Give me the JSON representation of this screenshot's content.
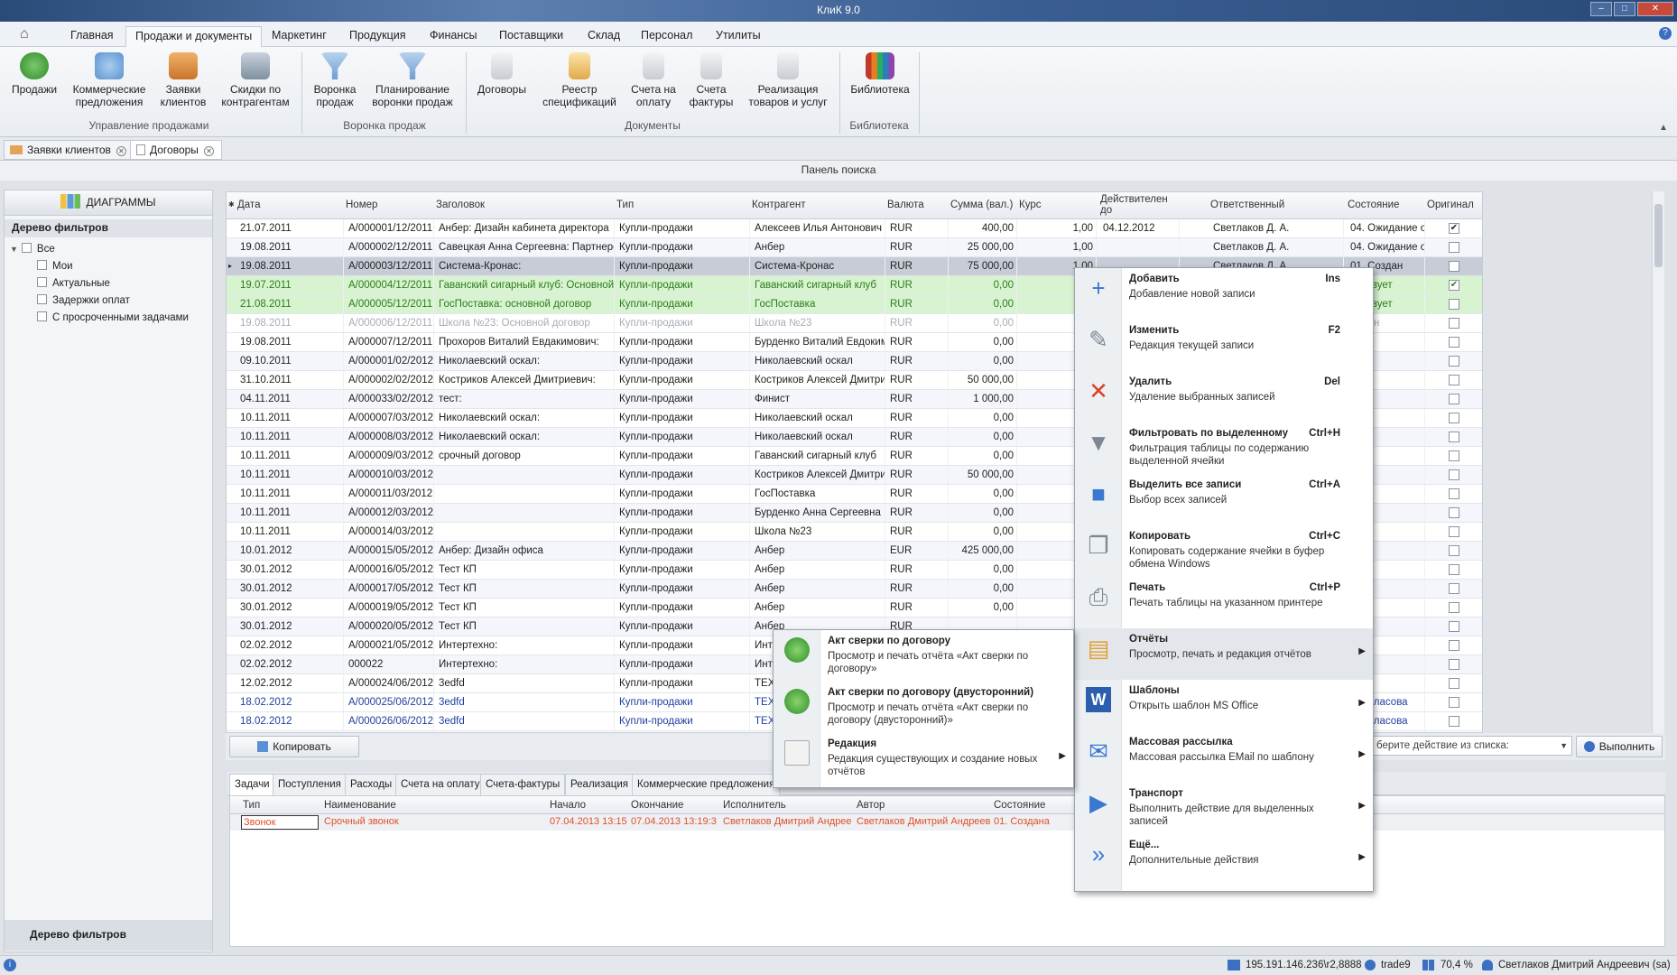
{
  "app": {
    "title": "КлиК 9.0"
  },
  "menu_tabs": [
    "Главная",
    "Продажи и документы",
    "Маркетинг",
    "Продукция",
    "Финансы",
    "Поставщики",
    "Склад",
    "Персонал",
    "Утилиты"
  ],
  "ribbon": {
    "buttons": [
      "Продажи",
      "Коммерческие предложения",
      "Заявки клиентов",
      "Скидки по контрагентам",
      "Воронка продаж",
      "Планирование воронки продаж",
      "Договоры",
      "Реестр спецификаций",
      "Счета на оплату",
      "Счета фактуры",
      "Реализация товаров и услуг",
      "Библиотека"
    ],
    "groups": [
      "Управление продажами",
      "Воронка продаж",
      "Документы",
      "Библиотека"
    ]
  },
  "doc_tabs": [
    "Заявки клиентов",
    "Договоры"
  ],
  "search_panel": "Панель поиска",
  "left": {
    "diagrams": "ДИАГРАММЫ",
    "tree_header": "Дерево фильтров",
    "tree_root": "Все",
    "tree_items": [
      "Мои",
      "Актуальные",
      "Задержки оплат",
      "С просроченными задачами"
    ],
    "tree_footer": "Дерево фильтров"
  },
  "grid": {
    "columns": [
      "Дата",
      "Номер",
      "Заголовок",
      "Тип",
      "Контрагент",
      "Валюта",
      "Сумма (вал.)",
      "Курс",
      "Действителен до",
      "Ответственный",
      "Состояние",
      "Оригинал"
    ],
    "rows": [
      [
        "21.07.2011",
        "A/000001/12/2011",
        "Анбер: Дизайн кабинета директора",
        "Купли-продажи",
        "Алексеев Илья Антонович",
        "RUR",
        "400,00",
        "1,00",
        "04.12.2012",
        "Светлаков Д. А.",
        "04. Ожидание ор"
      ],
      [
        "19.08.2011",
        "A/000002/12/2011",
        "Савецкая Анна Сергеевна: Партнерст",
        "Купли-продажи",
        "Анбер",
        "RUR",
        "25 000,00",
        "1,00",
        "",
        "Светлаков Д. А.",
        "04. Ожидание ор"
      ],
      [
        "19.08.2011",
        "A/000003/12/2011",
        "Система-Кронас:",
        "Купли-продажи",
        "Система-Кронас",
        "RUR",
        "75 000,00",
        "1,00",
        "",
        "Светлаков Д. А.",
        "01. Создан"
      ],
      [
        "19.07.2011",
        "A/000004/12/2011",
        "Гаванский сигарный клуб: Основной д",
        "Купли-продажи",
        "Гаванский сигарный клуб",
        "RUR",
        "0,00",
        "",
        "",
        "",
        "ействует"
      ],
      [
        "21.08.2011",
        "A/000005/12/2011",
        "ГосПоставка: основной договор",
        "Купли-продажи",
        "ГосПоставка",
        "RUR",
        "0,00",
        "",
        "",
        "",
        "ействует"
      ],
      [
        "19.08.2011",
        "A/000006/12/2011",
        "Школа №23: Основной договор",
        "Купли-продажи",
        "Школа №23",
        "RUR",
        "0,00",
        "",
        "",
        "",
        "лонен"
      ],
      [
        "19.08.2011",
        "A/000007/12/2011",
        "Прохоров Виталий Евдакимович:",
        "Купли-продажи",
        "Бурденко Виталий Евдокимо",
        "RUR",
        "0,00",
        "",
        "",
        "",
        "здан"
      ],
      [
        "09.10.2011",
        "A/000001/02/2012",
        "Николаевский оскал:",
        "Купли-продажи",
        "Николаевский оскал",
        "RUR",
        "0,00",
        "",
        "",
        "",
        "здан"
      ],
      [
        "31.10.2011",
        "A/000002/02/2012",
        "Костриков Алексей Дмитриевич:",
        "Купли-продажи",
        "Костриков Алексей Дмитрие",
        "RUR",
        "50 000,00",
        "",
        "",
        "",
        "здан"
      ],
      [
        "04.11.2011",
        "A/000033/02/2012",
        "тест:",
        "Купли-продажи",
        "Финист",
        "RUR",
        "1 000,00",
        "",
        "",
        "",
        "здан"
      ],
      [
        "10.11.2011",
        "A/000007/03/2012",
        "Николаевский оскал:",
        "Купли-продажи",
        "Николаевский оскал",
        "RUR",
        "0,00",
        "",
        "",
        "",
        "здан"
      ],
      [
        "10.11.2011",
        "A/000008/03/2012",
        "Николаевский оскал:",
        "Купли-продажи",
        "Николаевский оскал",
        "RUR",
        "0,00",
        "",
        "",
        "",
        "здан"
      ],
      [
        "10.11.2011",
        "A/000009/03/2012",
        "срочный договор",
        "Купли-продажи",
        "Гаванский сигарный клуб",
        "RUR",
        "0,00",
        "",
        "",
        "",
        "здан"
      ],
      [
        "10.11.2011",
        "A/000010/03/2012",
        "",
        "Купли-продажи",
        "Костриков Алексей Дмитрие",
        "RUR",
        "50 000,00",
        "",
        "",
        "",
        "здан"
      ],
      [
        "10.11.2011",
        "A/000011/03/2012",
        "",
        "Купли-продажи",
        "ГосПоставка",
        "RUR",
        "0,00",
        "",
        "",
        "",
        "здан"
      ],
      [
        "10.11.2011",
        "A/000012/03/2012",
        "",
        "Купли-продажи",
        "Бурденко Анна Сергеевна",
        "RUR",
        "0,00",
        "",
        "",
        "",
        "здан"
      ],
      [
        "10.11.2011",
        "A/000014/03/2012",
        "",
        "Купли-продажи",
        "Школа №23",
        "RUR",
        "0,00",
        "",
        "",
        "",
        "здан"
      ],
      [
        "10.01.2012",
        "A/000015/05/2012",
        "Анбер: Дизайн офиса",
        "Купли-продажи",
        "Анбер",
        "EUR",
        "425 000,00",
        "",
        "",
        "",
        "здан"
      ],
      [
        "30.01.2012",
        "A/000016/05/2012",
        "Тест КП",
        "Купли-продажи",
        "Анбер",
        "RUR",
        "0,00",
        "",
        "",
        "",
        "здан"
      ],
      [
        "30.01.2012",
        "A/000017/05/2012",
        "Тест КП",
        "Купли-продажи",
        "Анбер",
        "RUR",
        "0,00",
        "",
        "",
        "",
        "здан"
      ],
      [
        "30.01.2012",
        "A/000019/05/2012",
        "Тест КП",
        "Купли-продажи",
        "Анбер",
        "RUR",
        "0,00",
        "",
        "",
        "",
        "здан"
      ],
      [
        "30.01.2012",
        "A/000020/05/2012",
        "Тест КП",
        "Купли-продажи",
        "Анбер",
        "RUR",
        "",
        "",
        "",
        "",
        "здан"
      ],
      [
        "02.02.2012",
        "A/000021/05/2012",
        "Интертехно:",
        "Купли-продажи",
        "Инт",
        "",
        "",
        "",
        "",
        "",
        "здан"
      ],
      [
        "02.02.2012",
        "000022",
        "Интертехно:",
        "Купли-продажи",
        "Инт",
        "",
        "",
        "",
        "",
        "",
        "здан"
      ],
      [
        "12.02.2012",
        "A/000024/06/2012",
        "3edfd",
        "Купли-продажи",
        "ТЕХ",
        "",
        "",
        "",
        "",
        "",
        "здан"
      ],
      [
        "18.02.2012",
        "A/000025/06/2012",
        "3edfd",
        "Купли-продажи",
        "ТЕХ",
        "",
        "",
        "",
        "",
        "",
        "а согласова"
      ],
      [
        "18.02.2012",
        "A/000026/06/2012",
        "3edfd",
        "Купли-продажи",
        "ТЕХ",
        "",
        "",
        "",
        "",
        "",
        "а согласова"
      ]
    ]
  },
  "footer": {
    "copy_btn": "Копировать",
    "action_placeholder": "берите действие из списка:",
    "execute_btn": "Выполнить"
  },
  "bottom_tabs": [
    "Задачи",
    "Поступления",
    "Расходы",
    "Счета на оплату",
    "Счета-фактуры",
    "Реализация",
    "Коммерческие предложения"
  ],
  "subgrid": {
    "columns": [
      "Тип",
      "Наименование",
      "Начало",
      "Окончание",
      "Исполнитель",
      "Автор",
      "Состояние"
    ],
    "row": [
      "Звонок",
      "Срочный звонок",
      "07.04.2013 13:15",
      "07.04.2013 13:19:3",
      "Светлаков Дмитрий Андреев",
      "Светлаков Дмитрий Андреев",
      "01. Создана"
    ]
  },
  "context_menu": [
    {
      "title": "Добавить",
      "desc": "Добавление новой записи",
      "shortcut": "Ins",
      "icon": "plus-icon"
    },
    {
      "title": "Изменить",
      "desc": "Редакция текущей записи",
      "shortcut": "F2",
      "icon": "edit-icon"
    },
    {
      "title": "Удалить",
      "desc": "Удаление выбранных записей",
      "shortcut": "Del",
      "icon": "delete-icon"
    },
    {
      "title": "Фильтровать по выделенному",
      "desc": "Фильтрация таблицы по содержанию выделенной ячейки",
      "shortcut": "Ctrl+H",
      "icon": "filter-icon"
    },
    {
      "title": "Выделить все записи",
      "desc": "Выбор всех записей",
      "shortcut": "Ctrl+A",
      "icon": "select-all-icon"
    },
    {
      "title": "Копировать",
      "desc": "Копировать содержание ячейки в буфер обмена Windows",
      "shortcut": "Ctrl+C",
      "icon": "copy-icon"
    },
    {
      "title": "Печать",
      "desc": "Печать таблицы на указанном принтере",
      "shortcut": "Ctrl+P",
      "icon": "printer-icon"
    },
    {
      "title": "Отчёты",
      "desc": "Просмотр, печать и редакция отчётов",
      "shortcut": "",
      "icon": "clipboard-icon",
      "submenu": true
    },
    {
      "title": "Шаблоны",
      "desc": "Открыть шаблон MS Office",
      "shortcut": "",
      "icon": "word-icon",
      "submenu": true
    },
    {
      "title": "Массовая рассылка",
      "desc": "Массовая рассылка EMail по шаблону",
      "shortcut": "",
      "icon": "envelope-icon",
      "submenu": true
    },
    {
      "title": "Транспорт",
      "desc": "Выполнить действие для выделенных записей",
      "shortcut": "",
      "icon": "play-icon",
      "submenu": true
    },
    {
      "title": "Ещё...",
      "desc": "Дополнительные действия",
      "shortcut": "",
      "icon": "double-arrow-icon",
      "submenu": true
    }
  ],
  "reports_submenu": [
    {
      "title": "Акт сверки по договору",
      "desc": "Просмотр и печать отчёта «Акт сверки по договору»"
    },
    {
      "title": "Акт сверки по договору (двусторонний)",
      "desc": "Просмотр и печать отчёта «Акт сверки по договору (двусторонний)»"
    },
    {
      "title": "Редакция",
      "desc": "Редакция существующих и создание новых отчётов"
    }
  ],
  "status": {
    "server": "195.191.146.236\\r2,8888",
    "db": "trade9",
    "zoom": "70,4 %",
    "user": "Светлаков Дмитрий Андреевич (sa)"
  },
  "colors": {
    "accent": "#3b5e92",
    "green_row": "#d8f3d0",
    "selected_row": "#c7ccd6"
  }
}
